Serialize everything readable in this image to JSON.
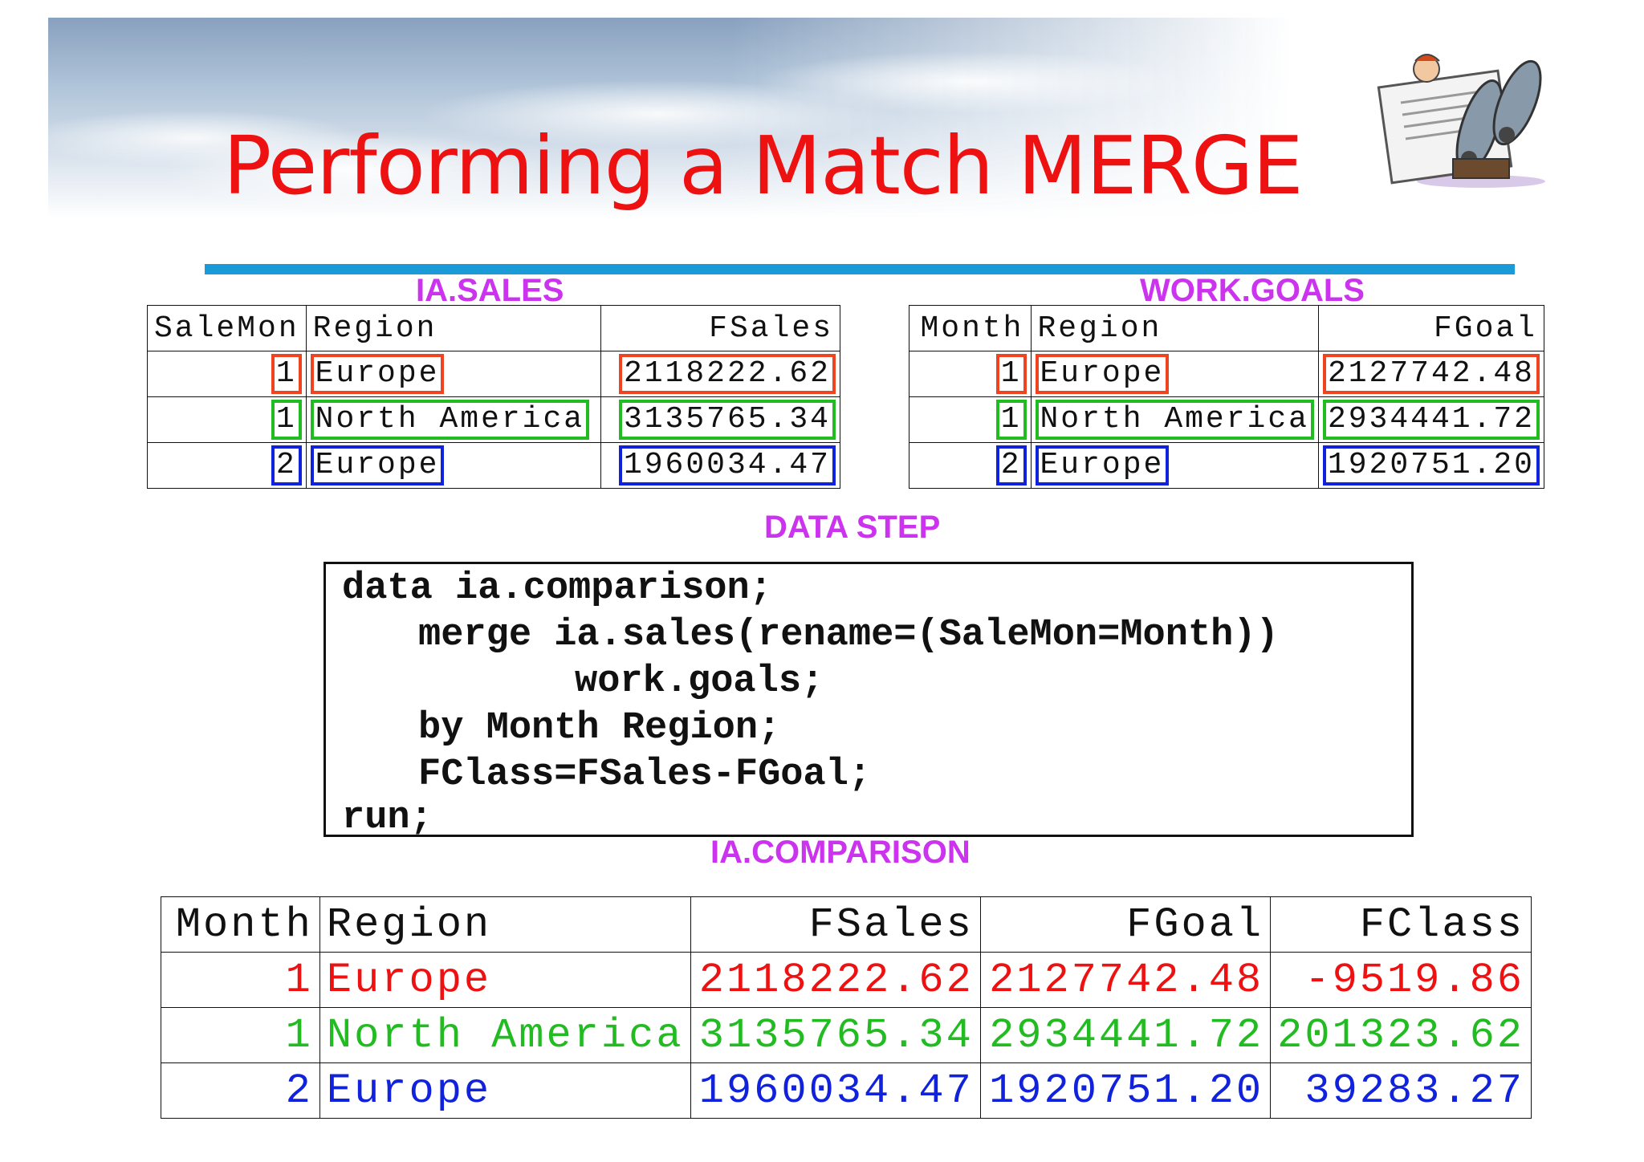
{
  "slide": {
    "title": "Performing a Match MERGE"
  },
  "sales": {
    "caption": "IA.SALES",
    "headers": [
      "SaleMon",
      "Region",
      "FSales"
    ],
    "rows": [
      {
        "month": "1",
        "region": "Europe",
        "value": "2118222.62"
      },
      {
        "month": "1",
        "region": "North America",
        "value": "3135765.34"
      },
      {
        "month": "2",
        "region": "Europe",
        "value": "1960034.47"
      }
    ]
  },
  "goals": {
    "caption": "WORK.GOALS",
    "headers": [
      "Month",
      "Region",
      "FGoal"
    ],
    "rows": [
      {
        "month": "1",
        "region": "Europe",
        "value": "2127742.48"
      },
      {
        "month": "1",
        "region": "North America",
        "value": "2934441.72"
      },
      {
        "month": "2",
        "region": "Europe",
        "value": "1920751.20"
      }
    ]
  },
  "datastep": {
    "caption": "DATA STEP",
    "lines": [
      "data ia.comparison;",
      "merge ia.sales(rename=(SaleMon=Month))",
      "work.goals;",
      "by Month Region;",
      "FClass=FSales-FGoal;",
      "run;"
    ]
  },
  "comparison": {
    "caption": "IA.COMPARISON",
    "headers": [
      "Month",
      "Region",
      "FSales",
      "FGoal",
      "FClass"
    ],
    "rows": [
      {
        "month": "1",
        "region": "Europe",
        "fsales": "2118222.62",
        "fgoal": "2127742.48",
        "fclass": "-9519.86"
      },
      {
        "month": "1",
        "region": "North America",
        "fsales": "3135765.34",
        "fgoal": "2934441.72",
        "fclass": "201323.62"
      },
      {
        "month": "2",
        "region": "Europe",
        "fsales": "1960034.47",
        "fgoal": "1920751.20",
        "fclass": "39283.27"
      }
    ]
  },
  "colors": {
    "title": "#ee1111",
    "caption": "#cc33ee",
    "rule": "#1a9ad6",
    "row1": "#ee4422",
    "row2": "#22bb22",
    "row3": "#1122dd"
  },
  "icons": [
    "cartoon-newspaper-reader-icon"
  ]
}
